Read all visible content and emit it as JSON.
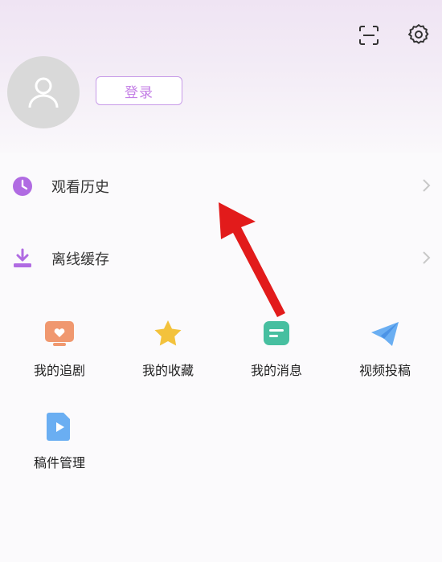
{
  "header": {
    "scan_icon": "scan-icon",
    "settings_icon": "gear-icon"
  },
  "profile": {
    "avatar_icon": "user-icon",
    "login_label": "登录"
  },
  "menu": [
    {
      "label": "观看历史",
      "icon": "clock-icon"
    },
    {
      "label": "离线缓存",
      "icon": "download-icon"
    }
  ],
  "grid": [
    {
      "label": "我的追剧",
      "icon": "tv-icon"
    },
    {
      "label": "我的收藏",
      "icon": "star-icon"
    },
    {
      "label": "我的消息",
      "icon": "message-icon"
    },
    {
      "label": "视频投稿",
      "icon": "paper-plane-icon"
    },
    {
      "label": "稿件管理",
      "icon": "video-file-icon"
    }
  ],
  "colors": {
    "accent": "#c47fe6",
    "menu_icon": "#b06be2",
    "arrow": "#e21b1b"
  }
}
